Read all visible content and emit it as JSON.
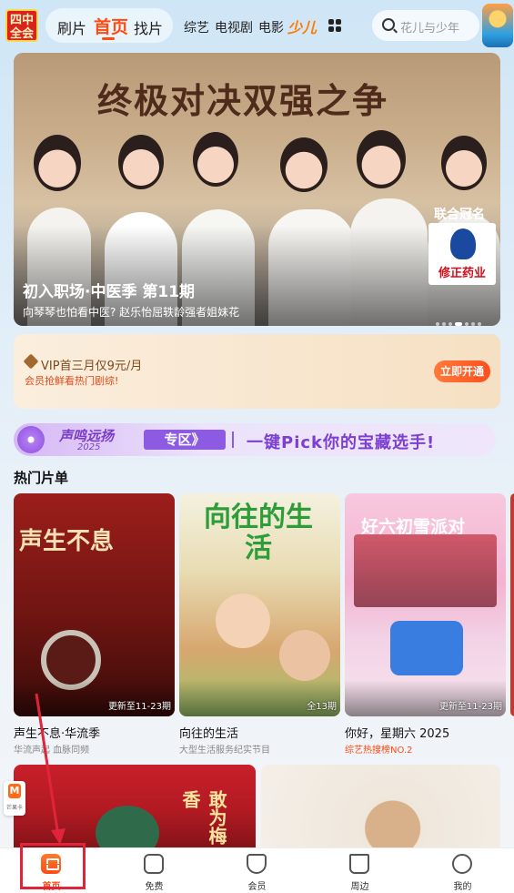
{
  "header": {
    "logo_text": "四中全会",
    "tabs": [
      "刷片",
      "首页",
      "找片"
    ],
    "active_tab": "首页",
    "channels": [
      "综艺",
      "电视剧",
      "电影",
      "少儿"
    ],
    "search_placeholder": "花儿与少年"
  },
  "banner": {
    "title": "终极对决双强之争",
    "caption": "初入职场·中医季 第11期",
    "subtitle": "向琴琴也怕看中医? 赵乐怡屈轶龄强者姐妹花",
    "sponsor_label": "联合冠名",
    "sponsor_name": "修正药业",
    "page_count": 7,
    "active_page": 3
  },
  "vip": {
    "title": "VIP首三月仅9元/月",
    "subtitle": "会员抢鲜看热门剧综!",
    "button": "立即开通"
  },
  "promo": {
    "brand": "声鸣远扬",
    "year": "2025",
    "zone": "专区》",
    "text": "一键Pick你的宝藏选手!"
  },
  "hot_list": {
    "title": "热门片单",
    "cards": [
      {
        "art": "声生不息",
        "name": "声生不息·华流季",
        "desc": "华流声起 血脉同频",
        "update": "更新至11-23期"
      },
      {
        "art": "向往的生活",
        "name": "向往的生活",
        "desc": "大型生活服务纪实节目",
        "update": "全13期"
      },
      {
        "art": "好六初雪派对",
        "name": "你好，星期六 2025",
        "desc": "综艺热搜榜NO.2",
        "update": "更新至11-23期"
      }
    ],
    "row2_title": "敢为梅香"
  },
  "mini_widget": {
    "letter": "M",
    "label": "芒果卡"
  },
  "tabbar": [
    {
      "label": "首页",
      "icon": "home-icon",
      "active": true
    },
    {
      "label": "免费",
      "icon": "free-icon",
      "active": false
    },
    {
      "label": "会员",
      "icon": "vip-icon",
      "active": false
    },
    {
      "label": "周边",
      "icon": "cart-icon",
      "active": false
    },
    {
      "label": "我的",
      "icon": "profile-icon",
      "active": false
    }
  ],
  "colors": {
    "accent": "#ff4a12",
    "annotation": "#e0253a",
    "promo": "#8d5ae2"
  }
}
